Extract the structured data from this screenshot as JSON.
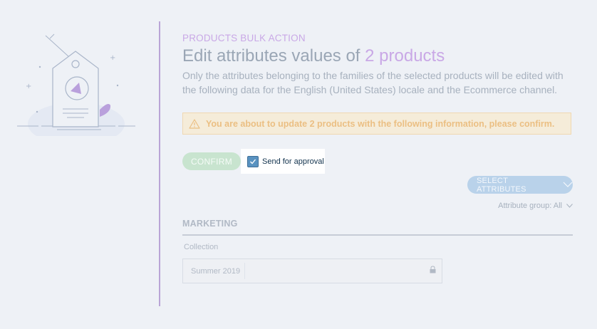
{
  "header": {
    "pre_title": "PRODUCTS BULK ACTION",
    "title_prefix": "Edit attributes values of",
    "title_count": "2 products",
    "description": "Only the attributes belonging to the families of the selected products will be edited with the following data for the English (United States) locale and the Ecommerce channel."
  },
  "warning": {
    "icon": "warning-icon",
    "text": "You are about to update 2 products with the following information, please confirm."
  },
  "actions": {
    "confirm_label": "CONFIRM",
    "send_for_approval_label": "Send for approval",
    "send_for_approval_checked": true,
    "select_attributes_label": "SELECT ATTRIBUTES",
    "attribute_group_label": "Attribute group: All"
  },
  "section": {
    "title": "MARKETING",
    "fields": [
      {
        "label": "Collection",
        "value": "Summer 2019",
        "locked": true
      }
    ]
  },
  "colors": {
    "accent_purple": "#c9a8e6",
    "confirm_green": "#c8e4cf",
    "select_blue": "#b9d2ea",
    "warning_bg": "#f5ecd9",
    "warning_text": "#ebbf83",
    "checkbox_blue": "#5992c0"
  }
}
